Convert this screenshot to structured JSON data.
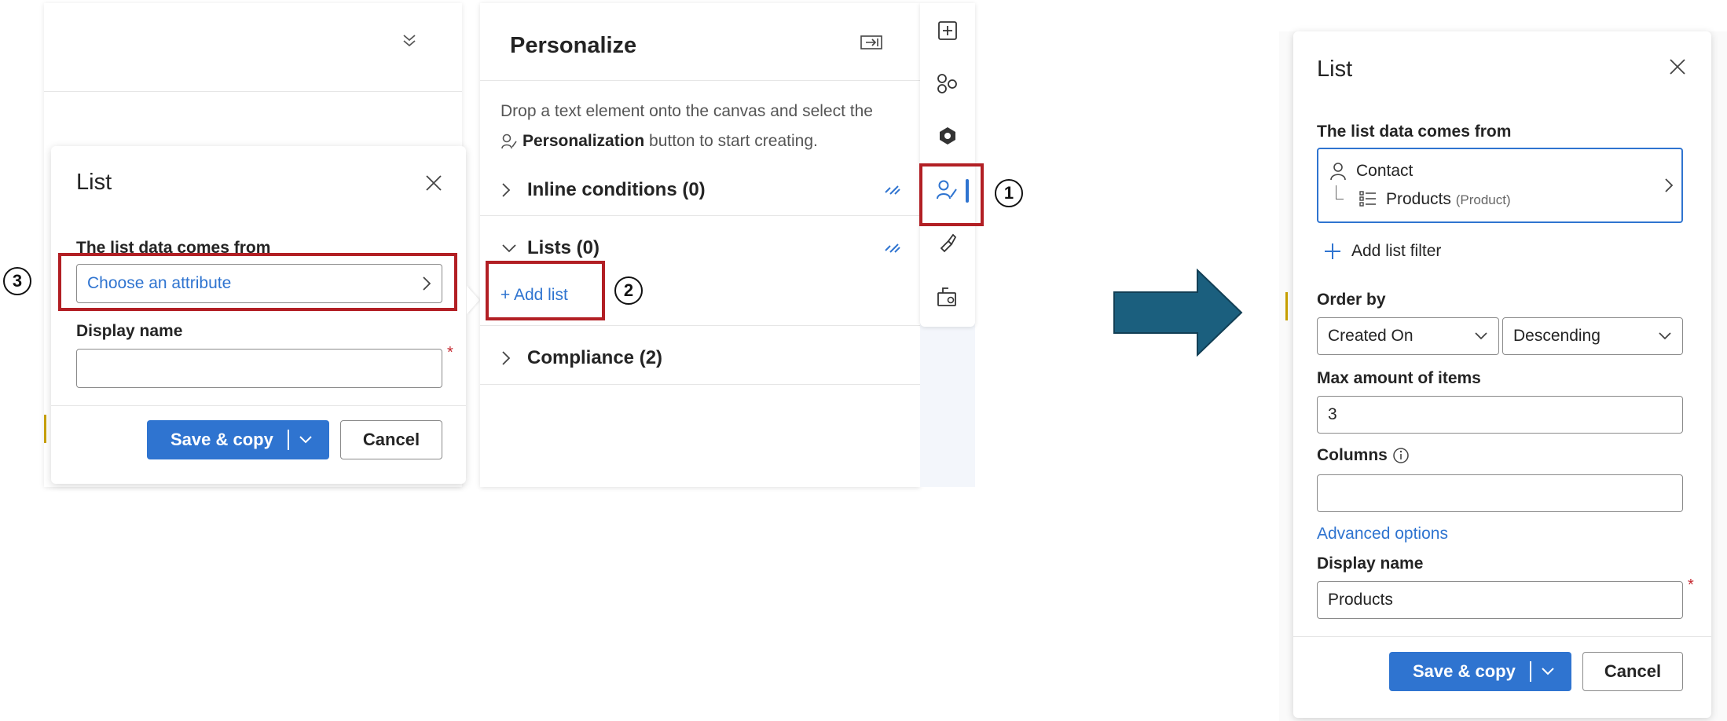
{
  "left_list_panel": {
    "title": "List",
    "data_label": "The list data comes from",
    "attribute_placeholder": "Choose an attribute",
    "display_name_label": "Display name",
    "required_marker": "*",
    "save_label": "Save & copy",
    "cancel_label": "Cancel"
  },
  "personalize": {
    "title": "Personalize",
    "intro_line1": "Drop a text element onto the canvas and select the",
    "intro_bold": "Personalization",
    "intro_line2_rest": " button to start creating.",
    "sections": [
      {
        "label": "Inline conditions (0)"
      },
      {
        "label": "Lists (0)"
      },
      {
        "label": "Compliance (2)"
      }
    ],
    "add_list_label": "+ Add list"
  },
  "markers": {
    "one": "1",
    "two": "2",
    "three": "3"
  },
  "right_list_panel": {
    "title": "List",
    "data_label": "The list data comes from",
    "source_entity": "Contact",
    "source_list": "Products",
    "source_list_type": "(Product)",
    "add_filter_label": "Add list filter",
    "order_by_label": "Order by",
    "order_field": "Created On",
    "order_direction": "Descending",
    "max_items_label": "Max amount of items",
    "max_items_value": "3",
    "columns_label": "Columns",
    "columns_value": "",
    "advanced_label": "Advanced options",
    "display_name_label": "Display name",
    "display_name_value": "Products",
    "required_marker": "*",
    "save_label": "Save & copy",
    "cancel_label": "Cancel"
  },
  "colors": {
    "accent": "#2f74d0",
    "highlight_border": "#b21f24",
    "arrow": "#1b5f7e",
    "required": "#c4262e"
  },
  "icons": {
    "toolbar": [
      "add-element-icon",
      "elements-icon",
      "copilot-icon",
      "personalization-icon",
      "styles-icon",
      "settings-icon"
    ]
  }
}
